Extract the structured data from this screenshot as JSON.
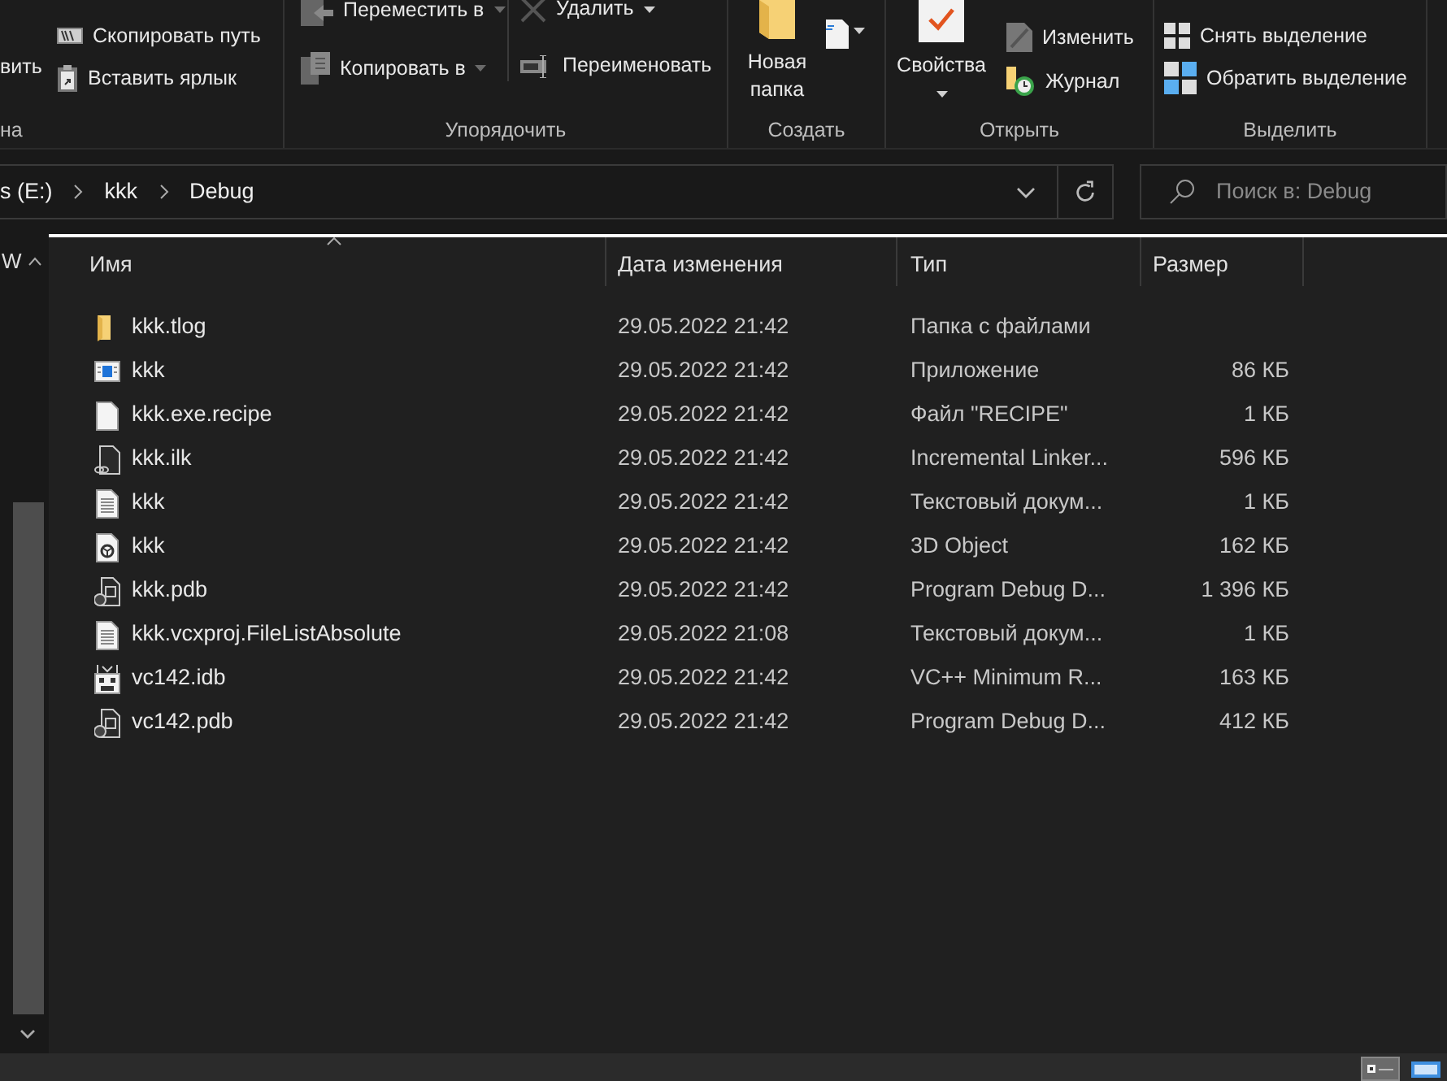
{
  "ribbon": {
    "groups": [
      {
        "kind": "clipboard",
        "label": "на",
        "items": [
          {
            "label": "вить"
          },
          {
            "kind": "copy_path",
            "label": "Скопировать путь"
          },
          {
            "kind": "paste_shortcut",
            "label": "Вставить ярлык"
          }
        ]
      },
      {
        "kind": "organize",
        "label": "Упорядочить",
        "items": [
          {
            "kind": "move",
            "label": "Переместить в",
            "has_menu": true
          },
          {
            "kind": "copy",
            "label": "Копировать в",
            "has_menu": true
          },
          {
            "kind": "delete",
            "label": "Удалить",
            "has_menu": true
          },
          {
            "kind": "rename",
            "label": "Переименовать"
          }
        ]
      },
      {
        "kind": "new",
        "label": "Создать",
        "items": [
          {
            "kind": "new_folder",
            "label": "Новая папка"
          },
          {
            "kind": "new_item",
            "has_menu": true
          }
        ]
      },
      {
        "kind": "open",
        "label": "Открыть",
        "items": [
          {
            "kind": "properties",
            "label": "Свойства",
            "has_menu": true
          },
          {
            "kind": "edit",
            "label": "Изменить"
          },
          {
            "kind": "history",
            "label": "Журнал"
          }
        ]
      },
      {
        "kind": "select",
        "label": "Выделить",
        "items": [
          {
            "kind": "select_none",
            "label": "Снять выделение"
          },
          {
            "kind": "invert",
            "label": "Обратить выделение"
          }
        ]
      }
    ]
  },
  "address": {
    "path": [
      "s (E:)",
      "kkk",
      "Debug"
    ]
  },
  "search": {
    "placeholder": "Поиск в: Debug"
  },
  "nav_pane": {
    "header": "W"
  },
  "columns": [
    {
      "label": "Имя",
      "sorted": true
    },
    {
      "label": "Дата изменения",
      "sorted": false
    },
    {
      "label": "Тип",
      "sorted": false
    },
    {
      "label": "Размер",
      "sorted": false
    }
  ],
  "rows": [
    {
      "kind": "folder",
      "name": "kkk.tlog",
      "date": "29.05.2022 21:42",
      "type": "Папка с файлами"
    },
    {
      "kind": "app",
      "name": "kkk",
      "date": "29.05.2022 21:42",
      "type": "Приложение",
      "size": "86 КБ"
    },
    {
      "kind": "blank",
      "name": "kkk.exe.recipe",
      "date": "29.05.2022 21:42",
      "type": "Файл \"RECIPE\"",
      "size": "1 КБ"
    },
    {
      "kind": "link",
      "name": "kkk.ilk",
      "date": "29.05.2022 21:42",
      "type": "Incremental Linker...",
      "size": "596 КБ"
    },
    {
      "kind": "text",
      "name": "kkk",
      "date": "29.05.2022 21:42",
      "type": "Текстовый докум...",
      "size": "1 КБ"
    },
    {
      "kind": "object3d",
      "name": "kkk",
      "date": "29.05.2022 21:42",
      "type": "3D Object",
      "size": "162 КБ"
    },
    {
      "kind": "pdb",
      "name": "kkk.pdb",
      "date": "29.05.2022 21:42",
      "type": "Program Debug D...",
      "size": "1 396 КБ"
    },
    {
      "kind": "text",
      "name": "kkk.vcxproj.FileListAbsolute",
      "date": "29.05.2022 21:08",
      "type": "Текстовый докум...",
      "size": "1 КБ"
    },
    {
      "kind": "idb",
      "name": "vc142.idb",
      "date": "29.05.2022 21:42",
      "type": "VC++ Minimum R...",
      "size": "163 КБ"
    },
    {
      "kind": "pdb",
      "name": "vc142.pdb",
      "date": "29.05.2022 21:42",
      "type": "Program Debug D...",
      "size": "412 КБ"
    }
  ],
  "status_bar": {
    "view_buttons": [
      {
        "kind": "details",
        "selected": true
      },
      {
        "kind": "tiles",
        "selected": false
      }
    ]
  }
}
